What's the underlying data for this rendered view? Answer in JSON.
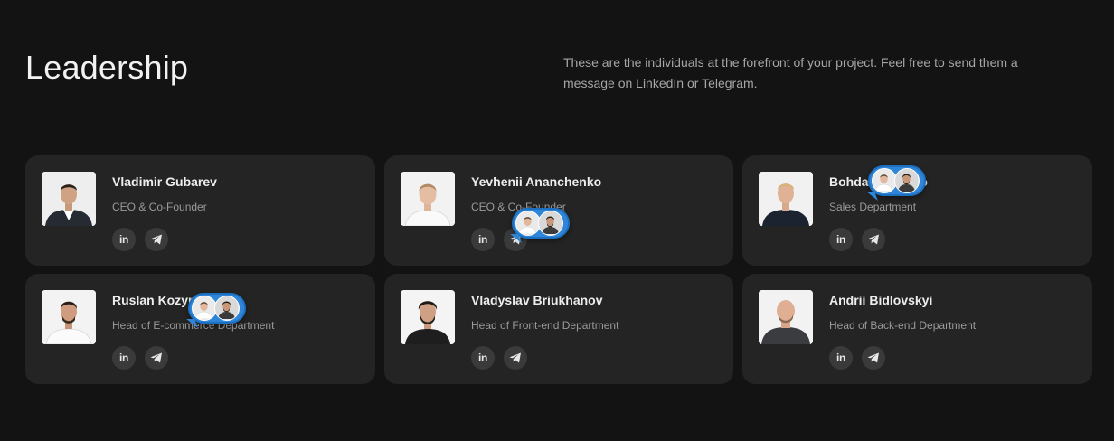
{
  "section": {
    "title": "Leadership",
    "description": "These are the individuals at the forefront of your project. Feel free to send them a message on LinkedIn or Telegram."
  },
  "members": [
    {
      "name": "Vladimir Gubarev",
      "role": "CEO & Co-Founder",
      "linkedin_icon": "linkedin-icon",
      "telegram_icon": "telegram-icon"
    },
    {
      "name": "Yevhenii Ananchenko",
      "role": "CEO & Co-Founder",
      "linkedin_icon": "linkedin-icon",
      "telegram_icon": "telegram-icon"
    },
    {
      "name": "Bohdan Makodo",
      "role": "Sales Department",
      "linkedin_icon": "linkedin-icon",
      "telegram_icon": "telegram-icon"
    },
    {
      "name": "Ruslan Kozyrev",
      "role": "Head of E-commerce Department",
      "linkedin_icon": "linkedin-icon",
      "telegram_icon": "telegram-icon"
    },
    {
      "name": "Vladyslav Briukhanov",
      "role": "Head of Front-end Department",
      "linkedin_icon": "linkedin-icon",
      "telegram_icon": "telegram-icon"
    },
    {
      "name": "Andrii Bidlovskyi",
      "role": "Head of Back-end Department",
      "linkedin_icon": "linkedin-icon",
      "telegram_icon": "telegram-icon"
    }
  ],
  "social": {
    "linkedin_label": "in"
  },
  "colors": {
    "background": "#131313",
    "card": "#242424",
    "social_button": "#3a3a3a",
    "chat_bubble": "#2f86d9"
  }
}
